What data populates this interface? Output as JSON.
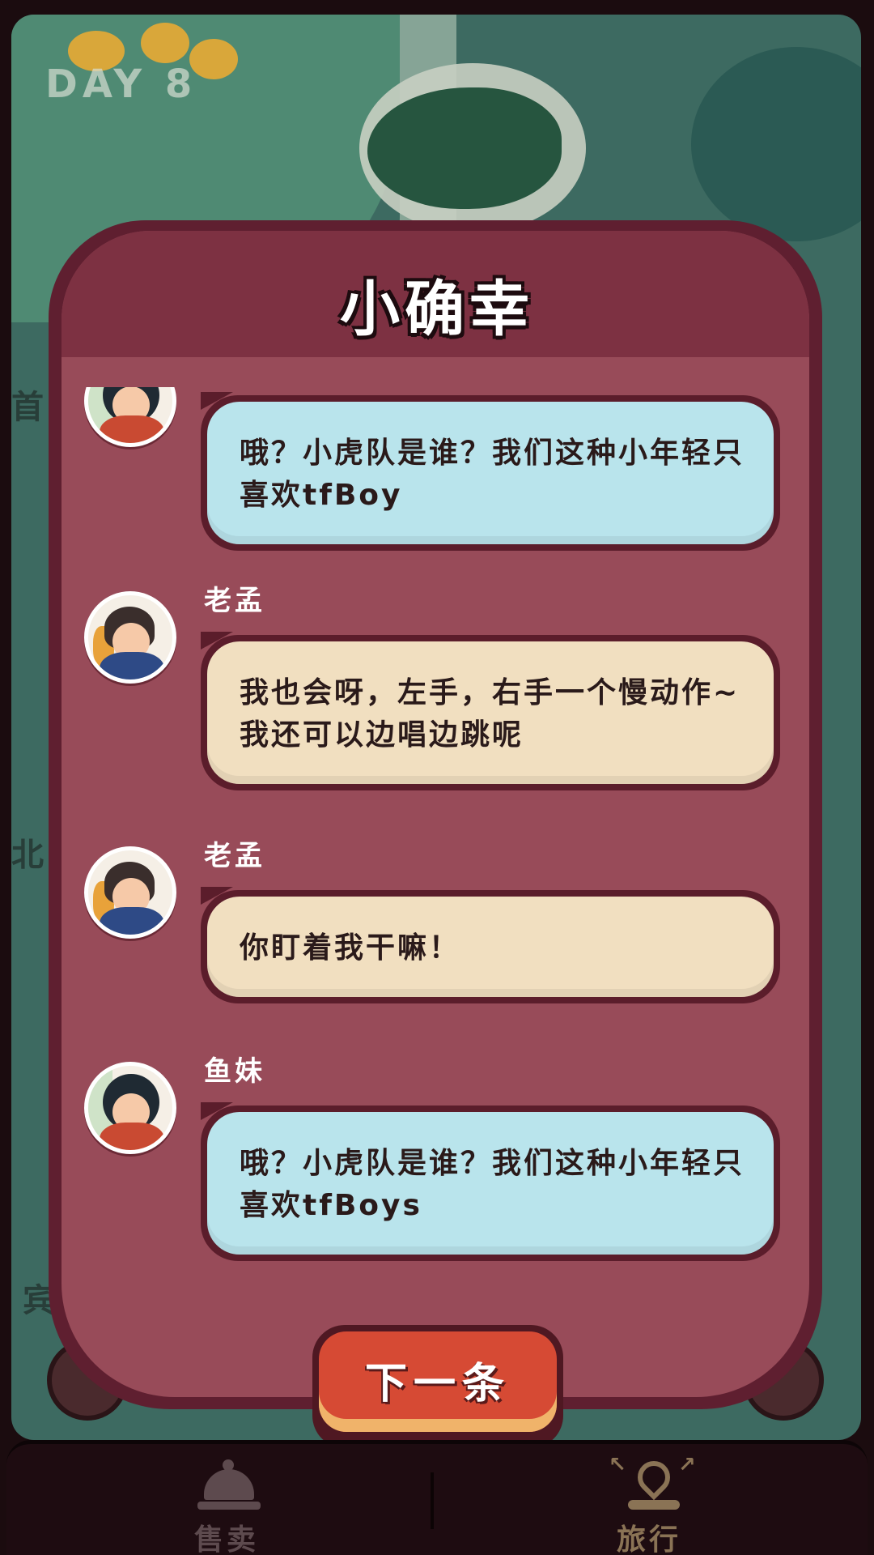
{
  "map": {
    "day_label": "DAY 8",
    "side_labels": [
      "首",
      "北",
      "宾"
    ]
  },
  "dialog": {
    "title": "小确幸",
    "messages": [
      {
        "speaker": "",
        "style": "blue",
        "text": "哦？小虎队是谁？我们这种小年轻只喜欢tfBoy"
      },
      {
        "speaker": "老孟",
        "style": "cream",
        "text": "我也会呀，左手，右手一个慢动作~我还可以边唱边跳呢"
      },
      {
        "speaker": "老孟",
        "style": "cream",
        "text": "你盯着我干嘛！"
      },
      {
        "speaker": "鱼妹",
        "style": "blue",
        "text": "哦？小虎队是谁？我们这种小年轻只喜欢tfBoys"
      }
    ],
    "next_button_label": "下一条"
  },
  "bottom_nav": {
    "tabs": [
      {
        "label": "售卖",
        "icon": "service-bell-icon"
      },
      {
        "label": "旅行",
        "icon": "travel-pin-icon"
      }
    ]
  },
  "colors": {
    "dialog_frame": "#5f1f30",
    "dialog_body": "#984b59",
    "bubble_blue": "#b9e4ec",
    "bubble_cream": "#f1dfc0",
    "next_button": "#d64a34"
  }
}
